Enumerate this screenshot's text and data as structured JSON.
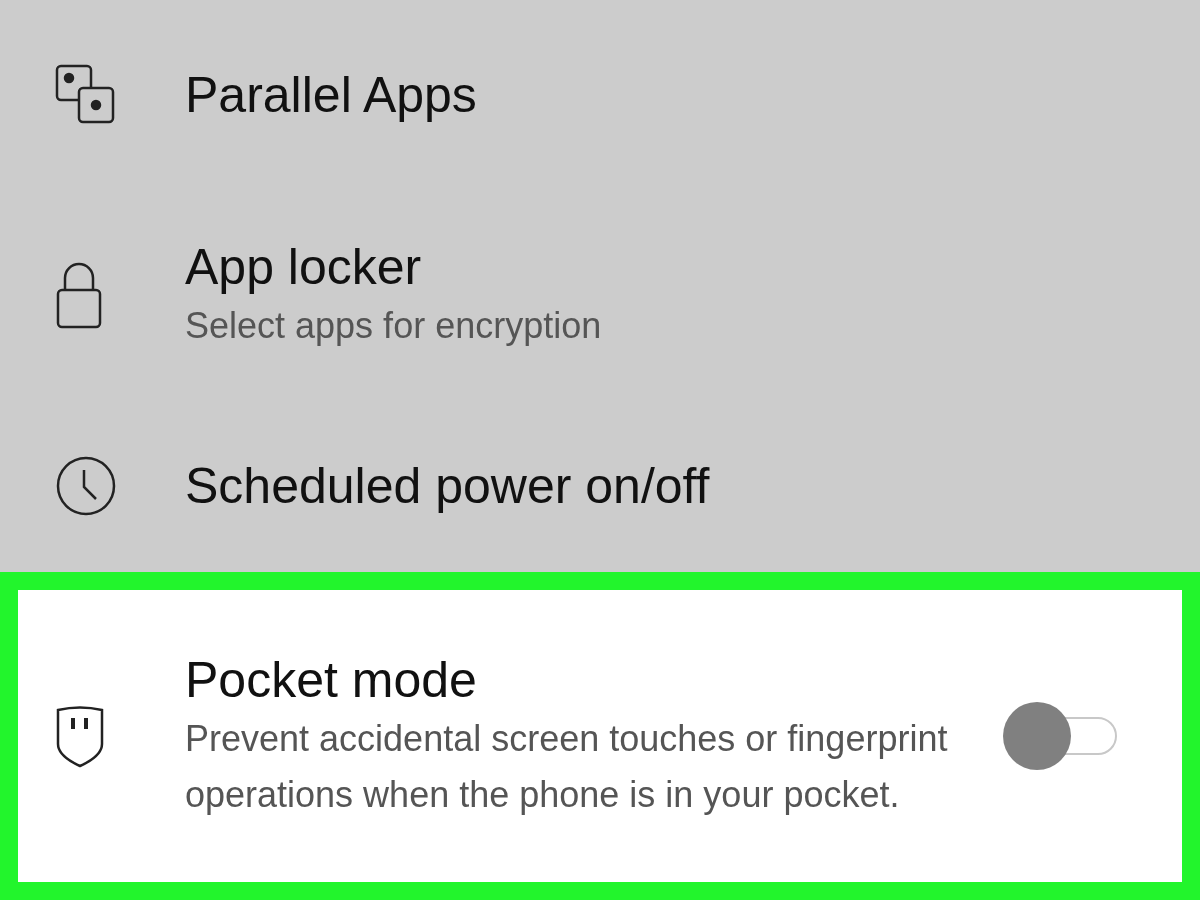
{
  "settings_items": [
    {
      "kind": "plain",
      "title": "Parallel Apps",
      "highlighted": false
    },
    {
      "kind": "plain",
      "title": "App locker",
      "subtitle": "Select apps for encryption",
      "highlighted": false
    },
    {
      "kind": "plain",
      "title": "Scheduled power on/off",
      "highlighted": false
    },
    {
      "kind": "toggle",
      "title": "Pocket mode",
      "subtitle": "Prevent accidental screen touches or fingerprint operations when the phone is in your pocket.",
      "on": false,
      "highlighted": true
    }
  ]
}
